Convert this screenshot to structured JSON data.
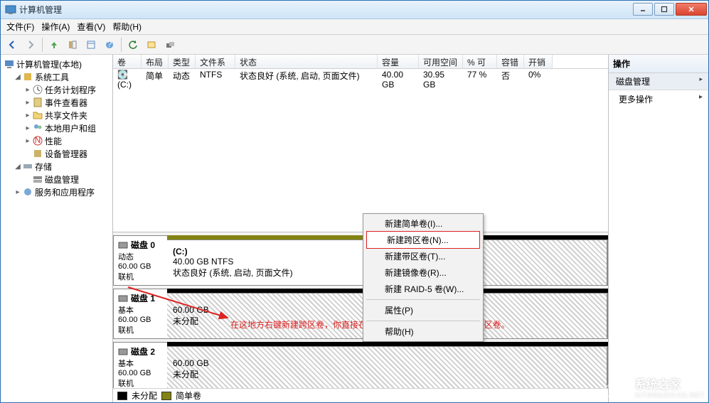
{
  "window": {
    "title": "计算机管理"
  },
  "menu": {
    "file": "文件(F)",
    "action": "操作(A)",
    "view": "查看(V)",
    "help": "帮助(H)"
  },
  "tree": {
    "root": "计算机管理(本地)",
    "system_tools": "系统工具",
    "task_scheduler": "任务计划程序",
    "event_viewer": "事件查看器",
    "shared_folders": "共享文件夹",
    "local_users": "本地用户和组",
    "performance": "性能",
    "device_manager": "设备管理器",
    "storage": "存储",
    "disk_management": "磁盘管理",
    "services_apps": "服务和应用程序"
  },
  "vol_headers": {
    "volume": "卷",
    "layout": "布局",
    "type": "类型",
    "fs": "文件系统",
    "status": "状态",
    "capacity": "容量",
    "free": "可用空间",
    "pct": "% 可用",
    "fault": "容错",
    "overhead": "开销"
  },
  "vol_row": {
    "volume": "(C:)",
    "layout": "简单",
    "type": "动态",
    "fs": "NTFS",
    "status": "状态良好 (系统, 启动, 页面文件)",
    "capacity": "40.00 GB",
    "free": "30.95 GB",
    "pct": "77 %",
    "fault": "否",
    "overhead": "0%"
  },
  "disks": {
    "d0": {
      "name": "磁盘 0",
      "kind": "动态",
      "size": "60.00 GB",
      "state": "联机",
      "partC": {
        "label": "(C:)",
        "line2": "40.00 GB NTFS",
        "line3": "状态良好 (系统, 启动, 页面文件)"
      }
    },
    "d1": {
      "name": "磁盘 1",
      "kind": "基本",
      "size": "60.00 GB",
      "state": "联机",
      "part": {
        "line1": "60.00 GB",
        "line2": "未分配"
      }
    },
    "d2": {
      "name": "磁盘 2",
      "kind": "基本",
      "size": "60.00 GB",
      "state": "联机",
      "part": {
        "line1": "60.00 GB",
        "line2": "未分配"
      }
    }
  },
  "legend": {
    "unallocated": "未分配",
    "simple": "简单卷"
  },
  "context_menu": {
    "simple": "新建简单卷(I)...",
    "spanned": "新建跨区卷(N)...",
    "striped": "新建带区卷(T)...",
    "mirrored": "新建镜像卷(R)...",
    "raid5": "新建 RAID-5 卷(W)...",
    "properties": "属性(P)",
    "help": "帮助(H)"
  },
  "actions": {
    "header": "操作",
    "disk_mgmt": "磁盘管理",
    "more": "更多操作"
  },
  "annotation": "在这地方右键新建跨区卷，你直接在已经分配C盘的那里建立不了跨区卷。",
  "watermark": {
    "text1": "系统之家",
    "text2": "XITONGZHIJIA.NET"
  }
}
